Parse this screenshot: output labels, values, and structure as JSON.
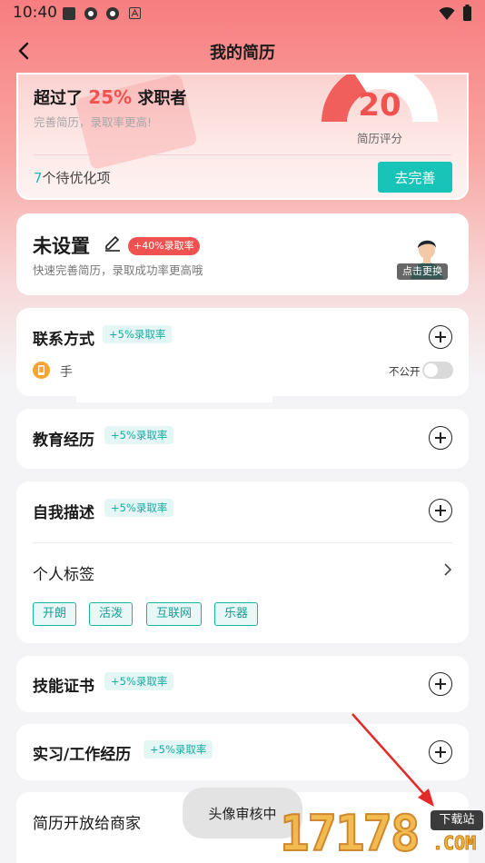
{
  "status_bar": {
    "time": "10:40"
  },
  "navbar": {
    "title": "我的简历"
  },
  "score_card": {
    "beat_prefix": "超过了",
    "beat_percent": "25%",
    "beat_suffix": "求职者",
    "subtitle": "完善简历，录取率更高!",
    "score": "20",
    "score_label": "简历评分",
    "todo_count": "7",
    "todo_label": "个待优化项",
    "complete_button": "去完善"
  },
  "profile": {
    "name": "未设置",
    "badge": "+40%录取率",
    "subtitle": "快速完善简历，录取成功率更高哦",
    "avatar_label": "点击更换"
  },
  "contact": {
    "title": "联系方式",
    "badge": "+5%录取率",
    "phone_label": "手",
    "private_label": "不公开",
    "private_on": false
  },
  "education": {
    "title": "教育经历",
    "badge": "+5%录取率"
  },
  "description": {
    "title": "自我描述",
    "badge": "+5%录取率",
    "tags_title": "个人标签",
    "tags": [
      "开朗",
      "活泼",
      "互联网",
      "乐器"
    ]
  },
  "skills": {
    "title": "技能证书",
    "badge": "+5%录取率"
  },
  "internship": {
    "title": "实习/工作经历",
    "badge": "+5%录取率"
  },
  "open_resume": {
    "title": "简历开放给商家"
  },
  "toast": {
    "text": "头像审核中"
  },
  "watermark": {
    "digits": "17178",
    "site": "下载站",
    "com": ".COM"
  },
  "colors": {
    "accent_red": "#f0534f",
    "accent_teal": "#18c4b7"
  }
}
